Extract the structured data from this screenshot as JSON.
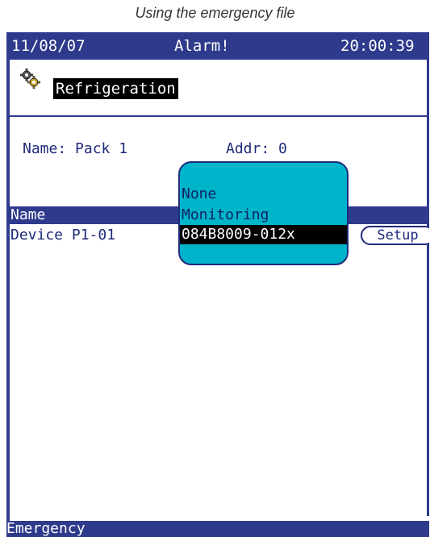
{
  "caption": "Using the emergency file",
  "title_bar": {
    "date": "11/08/07",
    "status": "Alarm!",
    "time": "20:00:39"
  },
  "header": {
    "icon": "gear-icon",
    "label": "Refrigeration"
  },
  "fields": {
    "name": "Name: Pack 1",
    "addr": "Addr: 0"
  },
  "table": {
    "column_header": "Name",
    "rows": [
      {
        "device": "Device P1-01",
        "action": "Setup"
      }
    ]
  },
  "popup": {
    "options": [
      "None",
      "Monitoring",
      "084B8009-012x"
    ],
    "selected": "084B8009-012x"
  },
  "status_bar": {
    "label": "Emergency"
  },
  "colors": {
    "screen_blue": "#2e3a8c",
    "popup_cyan": "#00b4cc",
    "text_blue": "#1e2a7a"
  }
}
